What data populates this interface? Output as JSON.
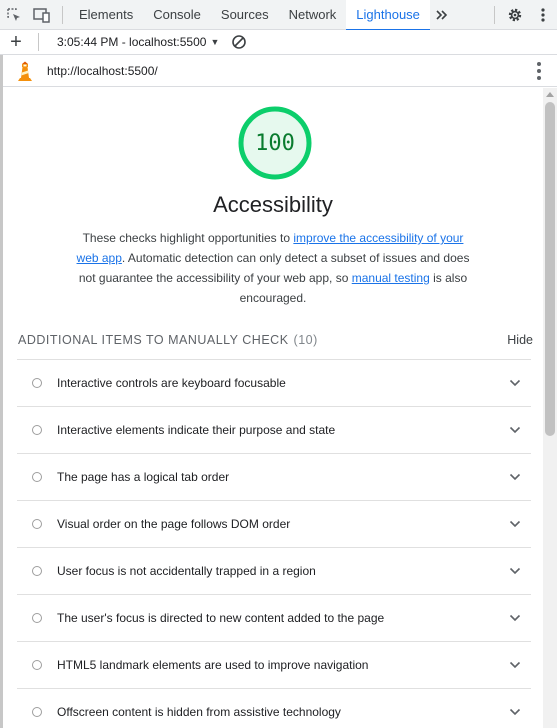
{
  "tabbar": {
    "tabs": [
      {
        "label": "Elements"
      },
      {
        "label": "Console"
      },
      {
        "label": "Sources"
      },
      {
        "label": "Network"
      },
      {
        "label": "Lighthouse",
        "active": true
      }
    ],
    "icons": [
      "inspect-icon",
      "device-toggle-icon",
      "more-tabs-icon",
      "settings-icon",
      "kebab-menu-icon"
    ]
  },
  "toolbar": {
    "report_label": "3:05:44 PM - localhost:5500"
  },
  "urlbar": {
    "url": "http://localhost:5500/"
  },
  "category": {
    "score": "100",
    "score_fraction": 1.0,
    "title": "Accessibility",
    "desc_1": "These checks highlight opportunities to ",
    "link_1": "improve the accessibility of your web app",
    "desc_2": ". Automatic detection can only detect a subset of issues and does not guarantee the accessibility of your web app, so ",
    "link_2": "manual testing",
    "desc_3": " is also encouraged."
  },
  "group": {
    "title": "ADDITIONAL ITEMS TO MANUALLY CHECK",
    "count": "(10)",
    "hide_label": "Hide"
  },
  "audits": [
    {
      "title": "Interactive controls are keyboard focusable"
    },
    {
      "title": "Interactive elements indicate their purpose and state"
    },
    {
      "title": "The page has a logical tab order"
    },
    {
      "title": "Visual order on the page follows DOM order"
    },
    {
      "title": "User focus is not accidentally trapped in a region"
    },
    {
      "title": "The user's focus is directed to new content added to the page"
    },
    {
      "title": "HTML5 landmark elements are used to improve navigation"
    },
    {
      "title": "Offscreen content is hidden from assistive technology"
    }
  ],
  "colors": {
    "accent": "#1a73e8",
    "pass_green": "#0cce6b",
    "pass_text": "#0a7c2f"
  }
}
